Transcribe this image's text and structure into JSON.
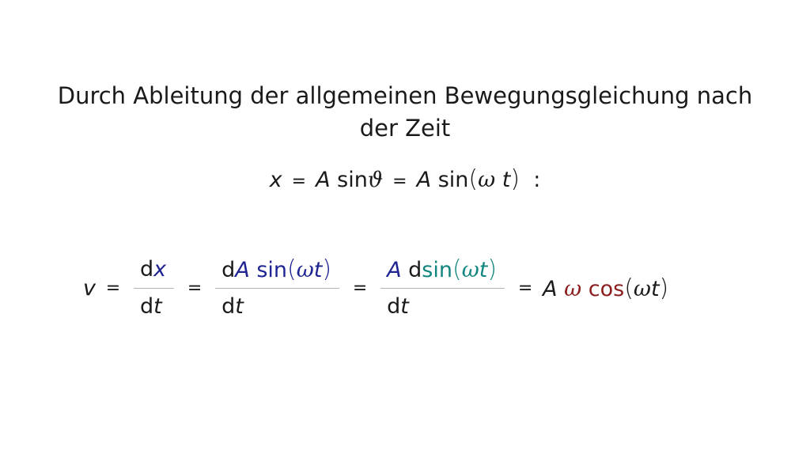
{
  "intro": {
    "text": "Durch Ableitung der allgemeinen Bewegungsgleichung nach der Zeit"
  },
  "equation1": {
    "x": "x",
    "eq": "=",
    "A": "A",
    "sin": "sin",
    "theta": "ϑ",
    "lparen": "(",
    "omega": "ω",
    "t": "t",
    "rparen": ")",
    "colon": ":"
  },
  "equation2": {
    "v": "v",
    "eq": "=",
    "d": "d",
    "x": "x",
    "t": "t",
    "A": "A",
    "sin": "sin",
    "cos": "cos",
    "omega": "ω",
    "lparen": "(",
    "rparen": ")"
  },
  "colors": {
    "text": "#1a1a1a",
    "navy": "#1f2493",
    "teal": "#118680",
    "maroon": "#8b1d1d",
    "fraction_bar": "#b4b4b4"
  }
}
